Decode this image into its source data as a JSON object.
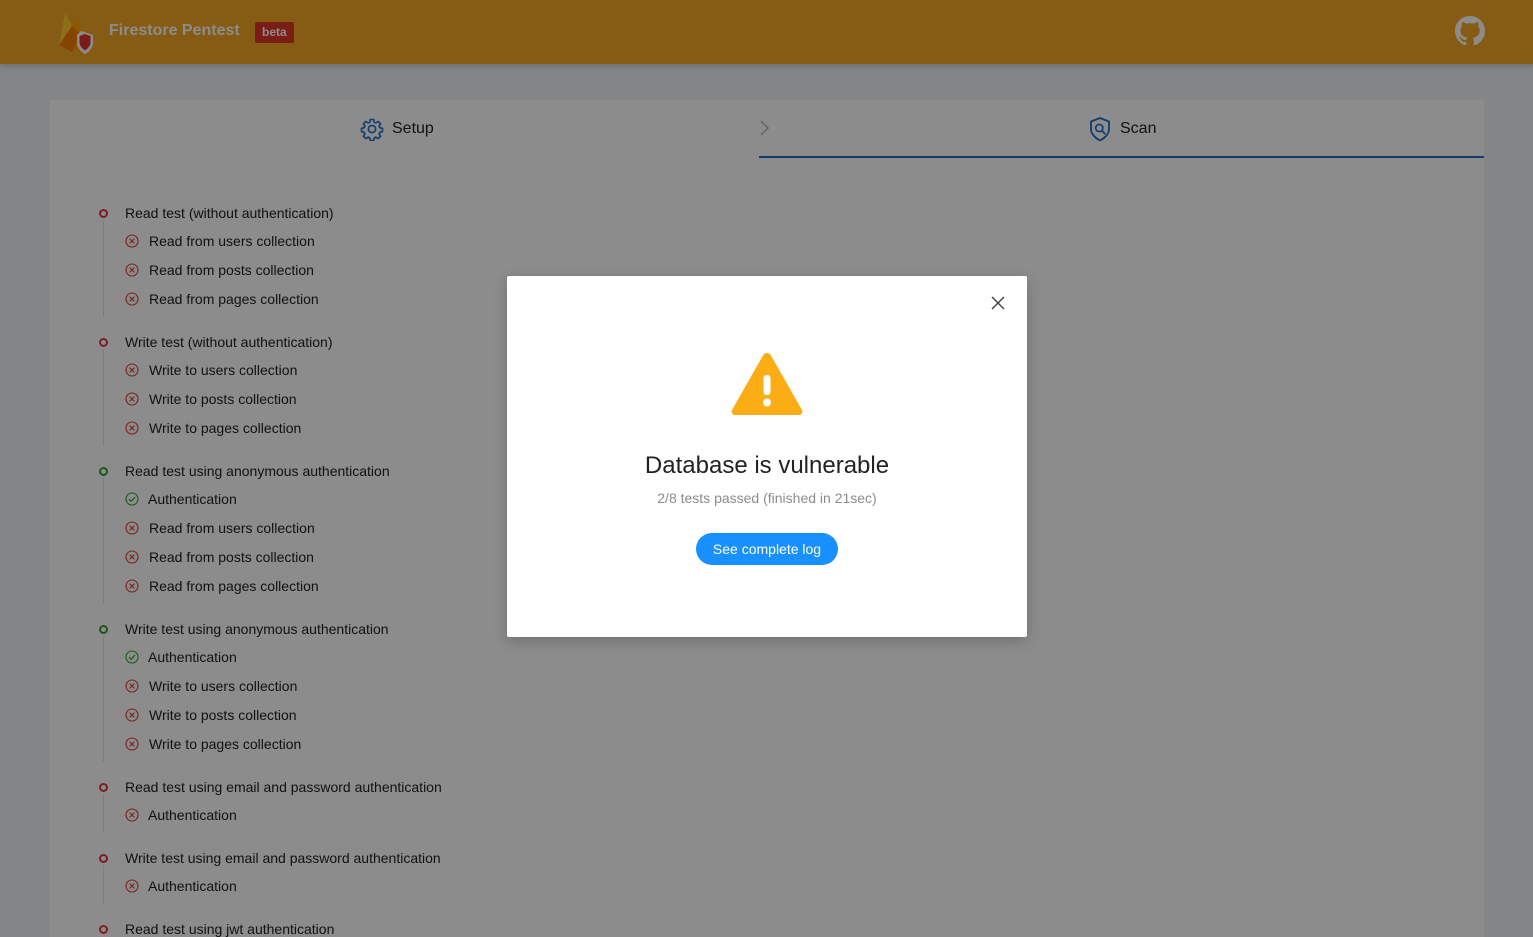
{
  "header": {
    "app_title": "Firestore Pentest",
    "badge": "beta",
    "logo_icon": "firebase-shield-icon",
    "github_icon": "github-icon"
  },
  "steps": [
    {
      "label": "Setup",
      "icon": "gear-icon",
      "active": false
    },
    {
      "label": "Scan",
      "icon": "shield-search-icon",
      "active": true
    }
  ],
  "colors": {
    "header": "#f5a623",
    "badge": "#e0352b",
    "fail": "#e0393e",
    "pass": "#2ea12e",
    "accent": "#1890ff",
    "warning": "#faad14",
    "step_active": "#1e6fc9"
  },
  "tests": [
    {
      "title": "Read test (without authentication)",
      "status": "fail",
      "items": [
        {
          "label": "Read from users collection",
          "status": "fail"
        },
        {
          "label": "Read from posts collection",
          "status": "fail"
        },
        {
          "label": "Read from pages collection",
          "status": "fail"
        }
      ]
    },
    {
      "title": "Write test (without authentication)",
      "status": "fail",
      "items": [
        {
          "label": "Write to users collection",
          "status": "fail"
        },
        {
          "label": "Write to posts collection",
          "status": "fail"
        },
        {
          "label": "Write to pages collection",
          "status": "fail"
        }
      ]
    },
    {
      "title": "Read test using anonymous authentication",
      "status": "pass",
      "items": [
        {
          "label": "Authentication",
          "status": "pass"
        },
        {
          "label": "Read from users collection",
          "status": "fail"
        },
        {
          "label": "Read from posts collection",
          "status": "fail"
        },
        {
          "label": "Read from pages collection",
          "status": "fail"
        }
      ]
    },
    {
      "title": "Write test using anonymous authentication",
      "status": "pass",
      "items": [
        {
          "label": "Authentication",
          "status": "pass"
        },
        {
          "label": "Write to users collection",
          "status": "fail"
        },
        {
          "label": "Write to posts collection",
          "status": "fail"
        },
        {
          "label": "Write to pages collection",
          "status": "fail"
        }
      ]
    },
    {
      "title": "Read test using email and password authentication",
      "status": "fail",
      "items": [
        {
          "label": "Authentication",
          "status": "fail"
        }
      ]
    },
    {
      "title": "Write test using email and password authentication",
      "status": "fail",
      "items": [
        {
          "label": "Authentication",
          "status": "fail"
        }
      ]
    },
    {
      "title": "Read test using jwt authentication",
      "status": "fail",
      "items": []
    }
  ],
  "modal": {
    "icon": "warning-icon",
    "title": "Database is vulnerable",
    "subtitle": "2/8 tests passed (finished in 21sec)",
    "button": "See complete log",
    "close_icon": "close-icon"
  }
}
